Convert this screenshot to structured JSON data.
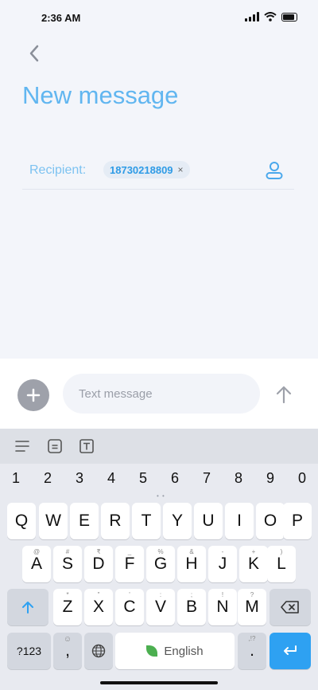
{
  "status": {
    "time": "2:36 AM"
  },
  "header": {
    "title": "New message"
  },
  "recipient": {
    "label": "Recipient:",
    "chip": "18730218809",
    "chip_remove": "×"
  },
  "compose": {
    "placeholder": "Text message"
  },
  "keyboard": {
    "numbers": [
      "1",
      "2",
      "3",
      "4",
      "5",
      "6",
      "7",
      "8",
      "9",
      "0"
    ],
    "row1": [
      "Q",
      "W",
      "E",
      "R",
      "T",
      "Y",
      "U",
      "I",
      "O",
      "P"
    ],
    "row2": [
      "A",
      "S",
      "D",
      "F",
      "G",
      "H",
      "J",
      "K",
      "L"
    ],
    "row2_hints": [
      "@",
      "#",
      "₹",
      "_",
      "%",
      "&",
      "-",
      "+",
      "(",
      ")"
    ],
    "row3": [
      "Z",
      "X",
      "C",
      "V",
      "B",
      "N",
      "M"
    ],
    "row3_hints": [
      "*",
      "\"",
      "'",
      ":",
      ";",
      "!",
      "?"
    ],
    "symbols_label": "?123",
    "comma": ",",
    "space_label": "English",
    "period": ".",
    "period_hint": ",!?"
  },
  "colors": {
    "accent": "#61b6f0",
    "blue_key": "#2ea1f2",
    "add_button": "#9ea1aa"
  }
}
